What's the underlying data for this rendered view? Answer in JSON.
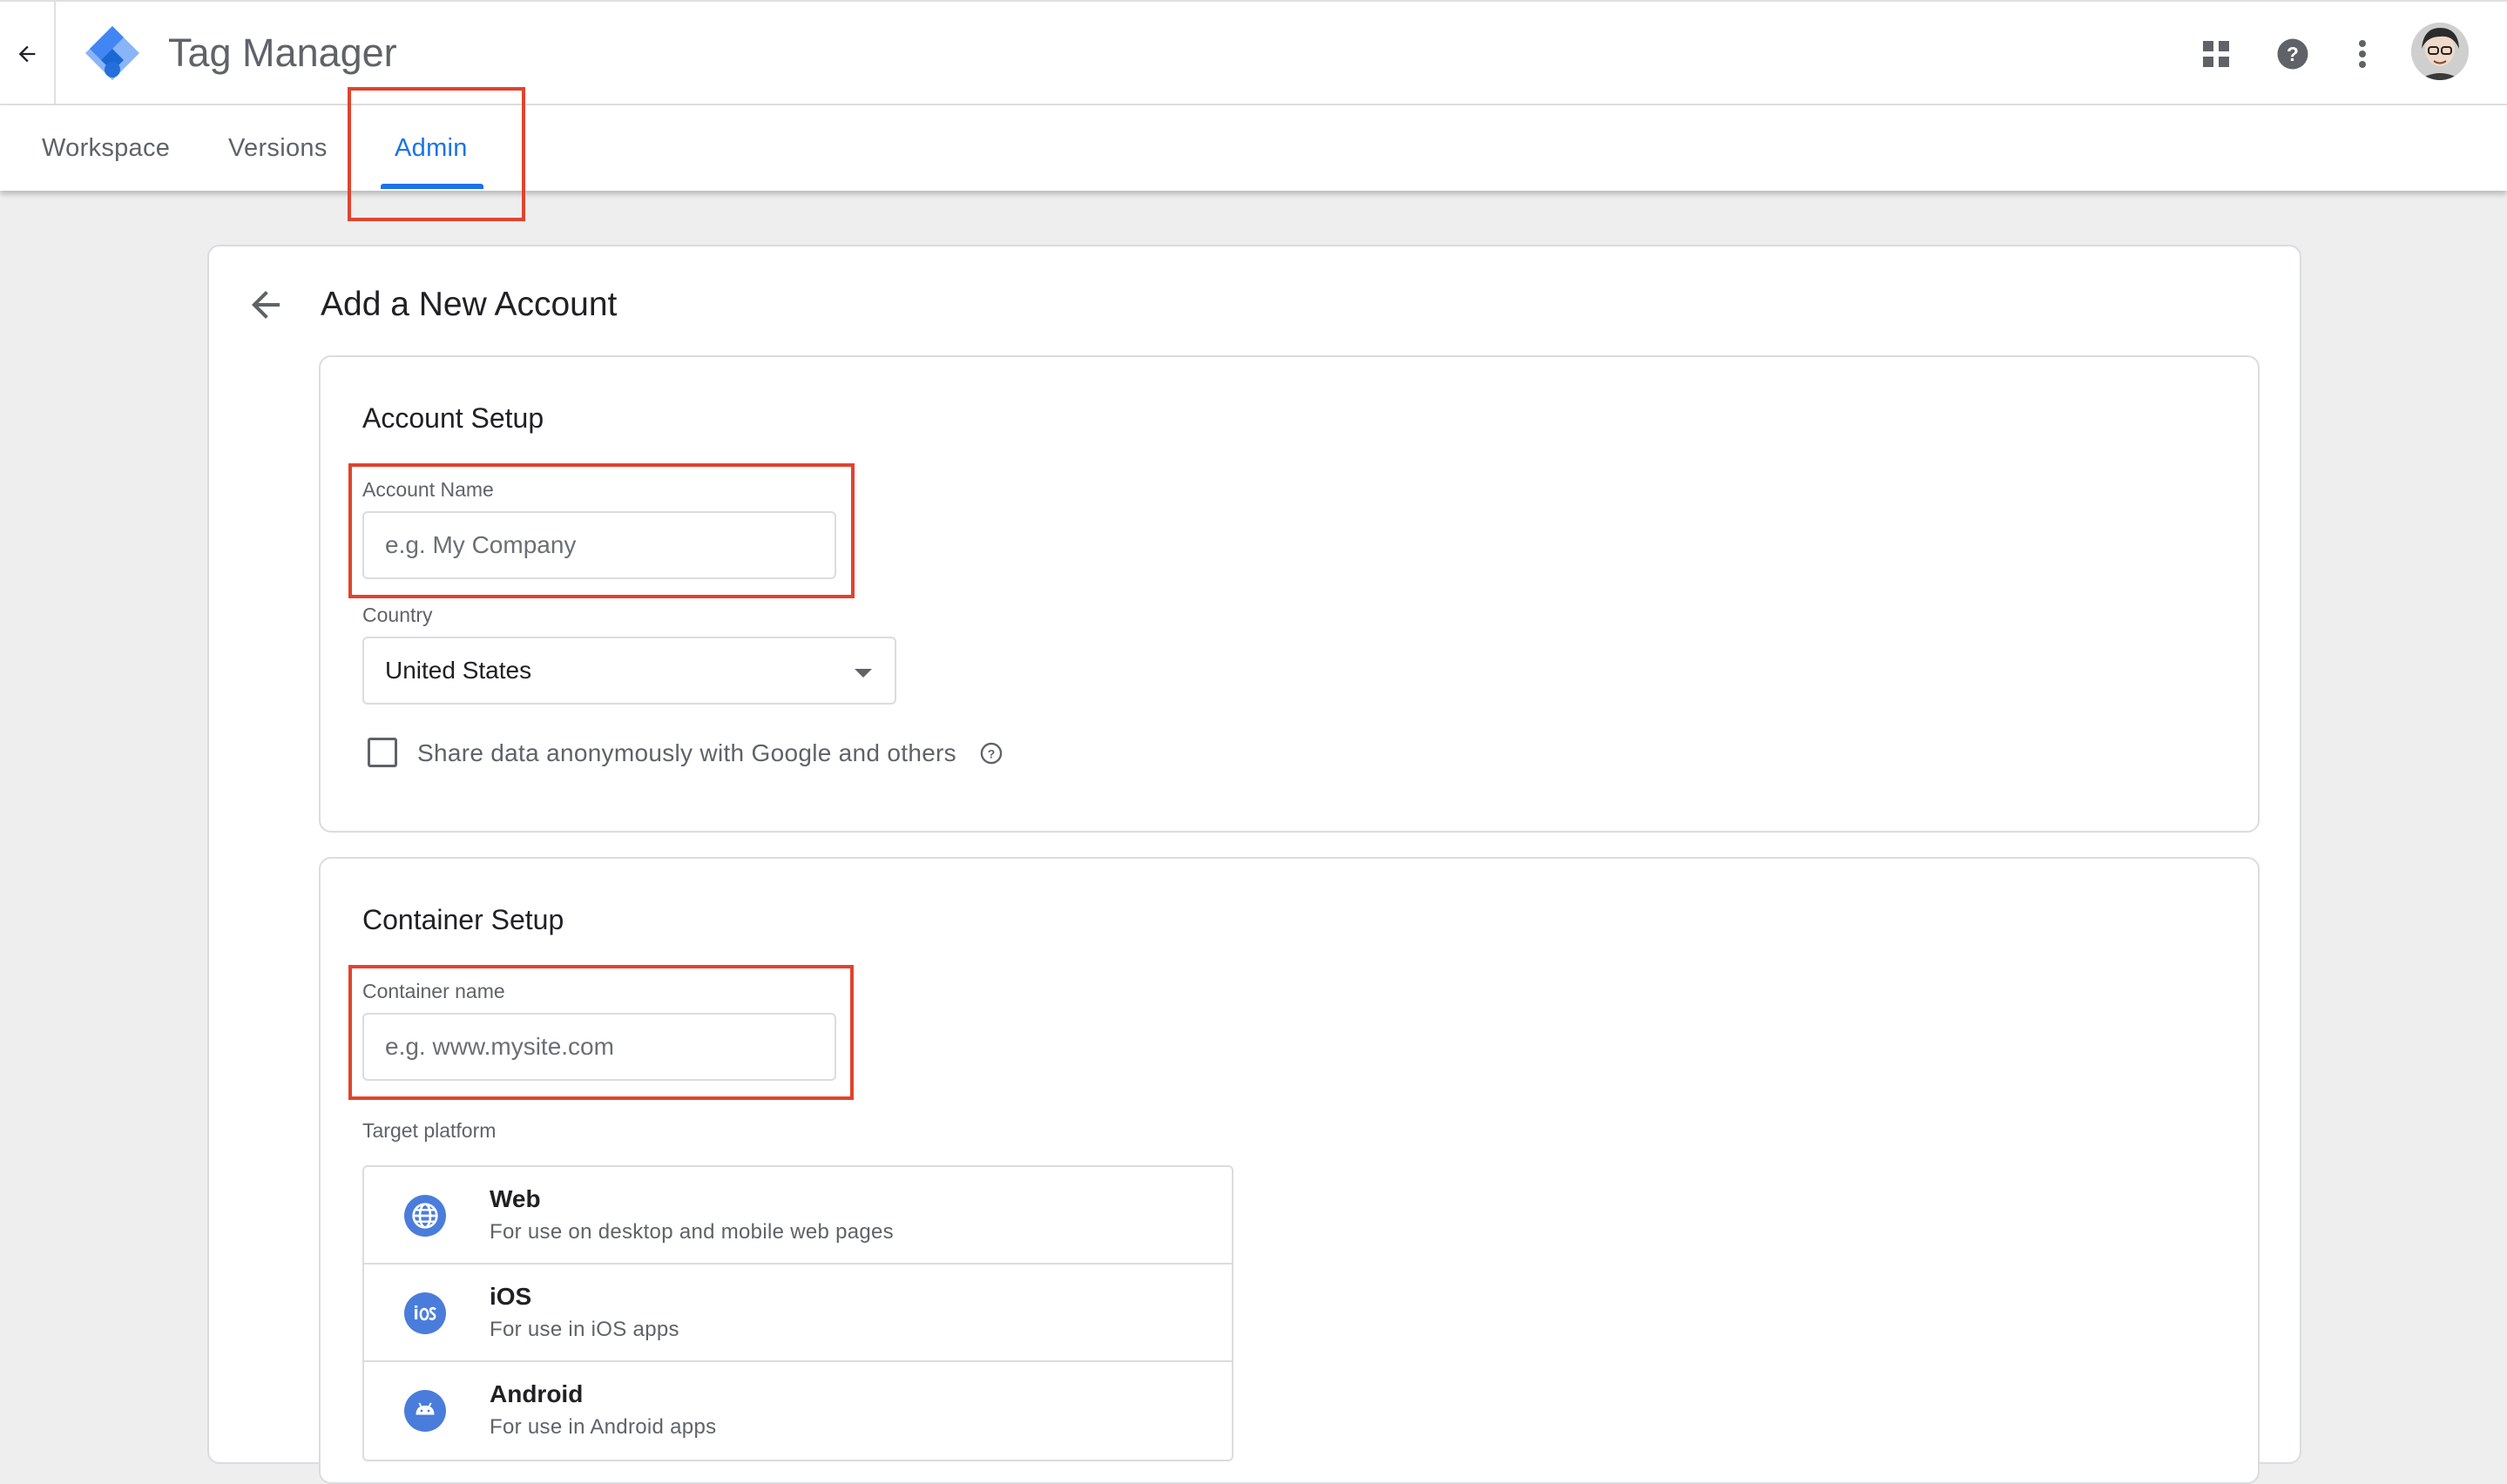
{
  "app": {
    "title": "Tag Manager",
    "accent_color": "#1a73e8",
    "annotation_color": "#e1432e"
  },
  "header": {
    "back_icon": "arrow-back-icon",
    "icons": [
      "apps-grid-icon",
      "help-icon",
      "more-vert-icon",
      "avatar"
    ]
  },
  "tabs": [
    {
      "label": "Workspace",
      "active": false
    },
    {
      "label": "Versions",
      "active": false
    },
    {
      "label": "Admin",
      "active": true
    }
  ],
  "page": {
    "title": "Add a New Account"
  },
  "account_setup": {
    "title": "Account Setup",
    "account_name": {
      "label": "Account Name",
      "placeholder": "e.g. My Company",
      "value": ""
    },
    "country": {
      "label": "Country",
      "value": "United States"
    },
    "share_data": {
      "label": "Share data anonymously with Google and others",
      "checked": false
    }
  },
  "container_setup": {
    "title": "Container Setup",
    "container_name": {
      "label": "Container name",
      "placeholder": "e.g. www.mysite.com",
      "value": ""
    },
    "target_platform": {
      "label": "Target platform",
      "options": [
        {
          "name": "Web",
          "description": "For use on desktop and mobile web pages",
          "icon": "globe-icon"
        },
        {
          "name": "iOS",
          "description": "For use in iOS apps",
          "icon": "ios-icon"
        },
        {
          "name": "Android",
          "description": "For use in Android apps",
          "icon": "android-icon"
        }
      ]
    }
  }
}
